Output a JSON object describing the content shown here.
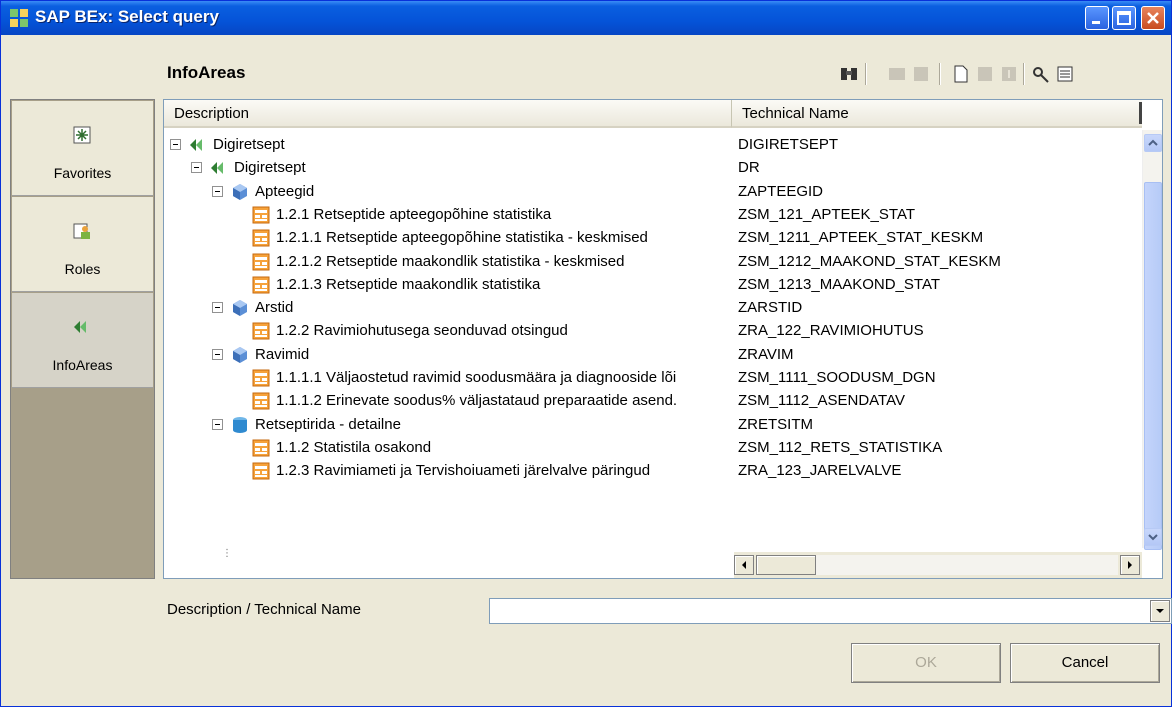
{
  "window": {
    "title": "SAP BEx: Select query"
  },
  "panel": {
    "title": "InfoAreas"
  },
  "toolbar": {
    "icons": [
      "find-icon",
      "mail-icon",
      "copy-icon",
      "new-icon",
      "edit-icon",
      "info-icon",
      "settings-icon",
      "details-icon"
    ]
  },
  "sidebar": {
    "items": [
      {
        "label": "Favorites",
        "icon": "favorites-icon"
      },
      {
        "label": "Roles",
        "icon": "roles-icon"
      },
      {
        "label": "InfoAreas",
        "icon": "infoareas-icon",
        "active": true
      }
    ]
  },
  "tree": {
    "columns": [
      "Description",
      "Technical Name"
    ],
    "rows": [
      {
        "level": 0,
        "type": "infoarea",
        "label": "Digiretsept",
        "tech": "DIGIRETSEPT",
        "expanded": true
      },
      {
        "level": 1,
        "type": "infoarea",
        "label": "Digiretsept",
        "tech": "DR",
        "expanded": true
      },
      {
        "level": 2,
        "type": "cube",
        "label": "Apteegid",
        "tech": "ZAPTEEGID",
        "expanded": true
      },
      {
        "level": 3,
        "type": "query",
        "label": "1.2.1 Retseptide apteegopõhine statistika",
        "tech": "ZSM_121_APTEEK_STAT"
      },
      {
        "level": 3,
        "type": "query",
        "label": "1.2.1.1 Retseptide apteegopõhine statistika - keskmised",
        "tech": "ZSM_1211_APTEEK_STAT_KESKM"
      },
      {
        "level": 3,
        "type": "query",
        "label": "1.2.1.2 Retseptide maakondlik statistika - keskmised",
        "tech": "ZSM_1212_MAAKOND_STAT_KESKM"
      },
      {
        "level": 3,
        "type": "query",
        "label": "1.2.1.3 Retseptide maakondlik statistika",
        "tech": "ZSM_1213_MAAKOND_STAT"
      },
      {
        "level": 2,
        "type": "cube",
        "label": "Arstid",
        "tech": "ZARSTID",
        "expanded": true
      },
      {
        "level": 3,
        "type": "query",
        "label": "1.2.2 Ravimiohutusega seonduvad otsingud",
        "tech": "ZRA_122_RAVIMIOHUTUS"
      },
      {
        "level": 2,
        "type": "cube",
        "label": "Ravimid",
        "tech": "ZRAVIM",
        "expanded": true
      },
      {
        "level": 3,
        "type": "query",
        "label": "1.1.1.1 Väljaostetud ravimid soodusmäära ja diagnooside lõi",
        "tech": "ZSM_1111_SOODUSM_DGN"
      },
      {
        "level": 3,
        "type": "query",
        "label": "1.1.1.2 Erinevate soodus% väljastataud preparaatide asend.",
        "tech": "ZSM_1112_ASENDATAV"
      },
      {
        "level": 2,
        "type": "ods",
        "label": "Retseptirida - detailne",
        "tech": "ZRETSITM",
        "expanded": true
      },
      {
        "level": 3,
        "type": "query",
        "label": "1.1.2 Statistila osakond",
        "tech": "ZSM_112_RETS_STATISTIKA"
      },
      {
        "level": 3,
        "type": "query",
        "label": "1.2.3 Ravimiameti ja Tervishoiuameti järelvalve päringud",
        "tech": "ZRA_123_JARELVALVE"
      }
    ]
  },
  "search": {
    "label": "Description / Technical Name",
    "value": ""
  },
  "buttons": {
    "ok": "OK",
    "cancel": "Cancel"
  },
  "colors": {
    "titlebar": "#0553d8",
    "dialog": "#ece9d8",
    "sidebar_bg": "#a79f89"
  }
}
